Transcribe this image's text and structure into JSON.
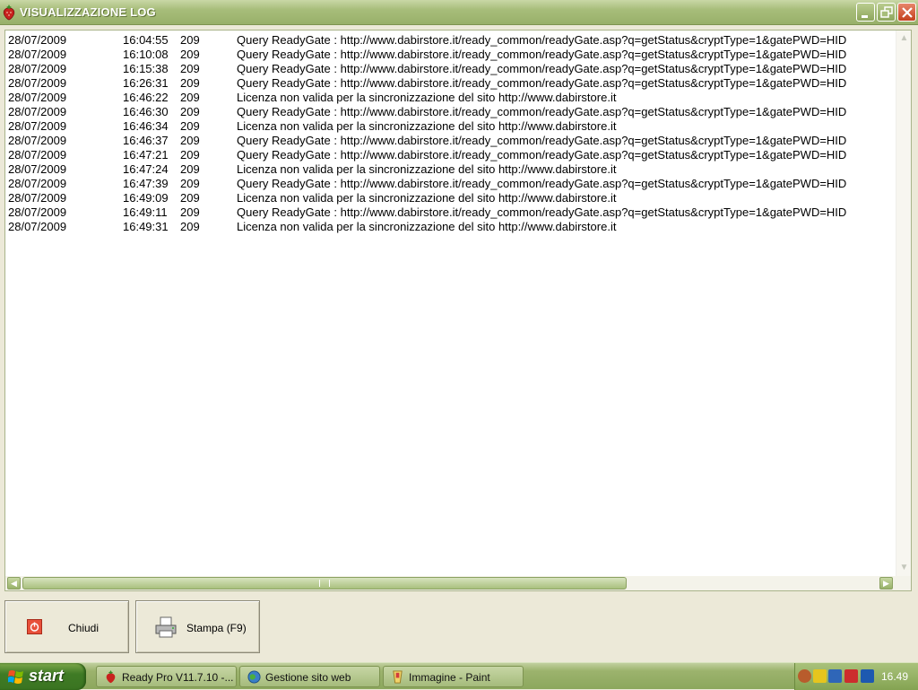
{
  "window": {
    "title": "VISUALIZZAZIONE LOG"
  },
  "log": {
    "rows": [
      {
        "date": "28/07/2009",
        "time": "16:04:55",
        "code": "209",
        "message": "Query ReadyGate : http://www.dabirstore.it/ready_common/readyGate.asp?q=getStatus&cryptType=1&gatePWD=HID"
      },
      {
        "date": "28/07/2009",
        "time": "16:10:08",
        "code": "209",
        "message": "Query ReadyGate : http://www.dabirstore.it/ready_common/readyGate.asp?q=getStatus&cryptType=1&gatePWD=HID"
      },
      {
        "date": "28/07/2009",
        "time": "16:15:38",
        "code": "209",
        "message": "Query ReadyGate : http://www.dabirstore.it/ready_common/readyGate.asp?q=getStatus&cryptType=1&gatePWD=HID"
      },
      {
        "date": "28/07/2009",
        "time": "16:26:31",
        "code": "209",
        "message": "Query ReadyGate : http://www.dabirstore.it/ready_common/readyGate.asp?q=getStatus&cryptType=1&gatePWD=HID"
      },
      {
        "date": "28/07/2009",
        "time": "16:46:22",
        "code": "209",
        "message": "Licenza non valida per la sincronizzazione del sito http://www.dabirstore.it"
      },
      {
        "date": "28/07/2009",
        "time": "16:46:30",
        "code": "209",
        "message": "Query ReadyGate : http://www.dabirstore.it/ready_common/readyGate.asp?q=getStatus&cryptType=1&gatePWD=HID"
      },
      {
        "date": "28/07/2009",
        "time": "16:46:34",
        "code": "209",
        "message": "Licenza non valida per la sincronizzazione del sito http://www.dabirstore.it"
      },
      {
        "date": "28/07/2009",
        "time": "16:46:37",
        "code": "209",
        "message": "Query ReadyGate : http://www.dabirstore.it/ready_common/readyGate.asp?q=getStatus&cryptType=1&gatePWD=HID"
      },
      {
        "date": "28/07/2009",
        "time": "16:47:21",
        "code": "209",
        "message": "Query ReadyGate : http://www.dabirstore.it/ready_common/readyGate.asp?q=getStatus&cryptType=1&gatePWD=HID"
      },
      {
        "date": "28/07/2009",
        "time": "16:47:24",
        "code": "209",
        "message": "Licenza non valida per la sincronizzazione del sito http://www.dabirstore.it"
      },
      {
        "date": "28/07/2009",
        "time": "16:47:39",
        "code": "209",
        "message": "Query ReadyGate : http://www.dabirstore.it/ready_common/readyGate.asp?q=getStatus&cryptType=1&gatePWD=HID"
      },
      {
        "date": "28/07/2009",
        "time": "16:49:09",
        "code": "209",
        "message": "Licenza non valida per la sincronizzazione del sito http://www.dabirstore.it"
      },
      {
        "date": "28/07/2009",
        "time": "16:49:11",
        "code": "209",
        "message": "Query ReadyGate : http://www.dabirstore.it/ready_common/readyGate.asp?q=getStatus&cryptType=1&gatePWD=HID"
      },
      {
        "date": "28/07/2009",
        "time": "16:49:31",
        "code": "209",
        "message": "Licenza non valida per la sincronizzazione del sito http://www.dabirstore.it"
      }
    ]
  },
  "buttons": {
    "close_label": "Chiudi",
    "print_label": "Stampa (F9)"
  },
  "taskbar": {
    "start_label": "start",
    "tasks": [
      {
        "label": "Ready Pro V11.7.10 -...",
        "icon": "strawberry-icon"
      },
      {
        "label": "Gestione sito web",
        "icon": "globe-icon"
      },
      {
        "label": "Immagine - Paint",
        "icon": "paint-icon"
      }
    ],
    "clock": "16.49"
  },
  "colors": {
    "titlebar": "#98b06a",
    "close_button": "#c4411d",
    "start_button": "#3f7b25"
  }
}
